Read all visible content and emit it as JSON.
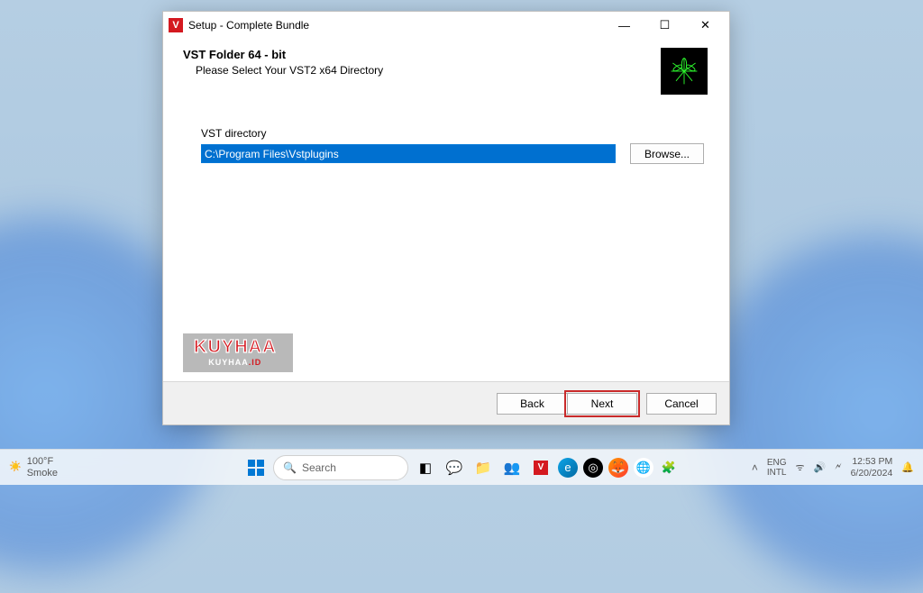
{
  "window": {
    "title": "Setup - Complete Bundle",
    "header_title": "VST Folder 64 - bit",
    "header_subtitle": "Please Select Your VST2 x64 Directory",
    "field_label": "VST directory",
    "directory_value": "C:\\Program Files\\Vstplugins",
    "browse_label": "Browse...",
    "back_label": "Back",
    "next_label": "Next",
    "cancel_label": "Cancel"
  },
  "watermark": {
    "big": "KUYHAA",
    "small_a": "KUYHAA",
    "small_b": ".ID"
  },
  "taskbar": {
    "weather_temp": "100°F",
    "weather_cond": "Smoke",
    "search_placeholder": "Search",
    "lang1": "ENG",
    "lang2": "INTL",
    "time": "12:53 PM",
    "date": "6/20/2024"
  }
}
